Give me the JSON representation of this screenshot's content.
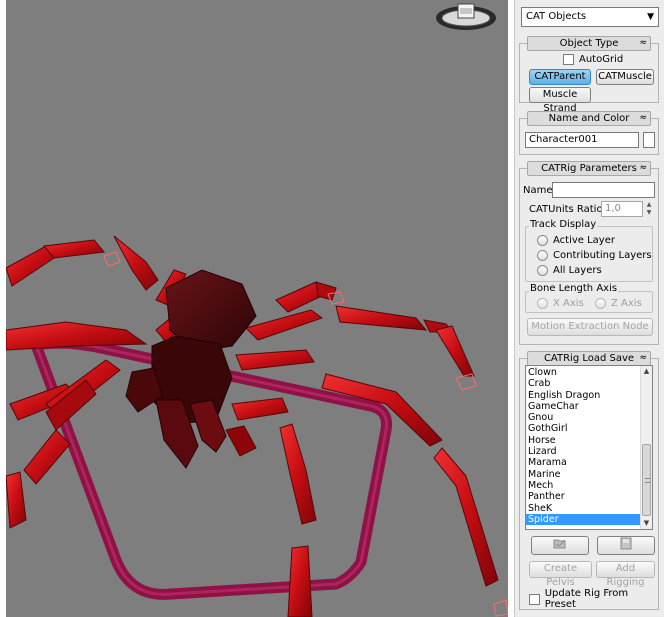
{
  "panel": {
    "category_dropdown": "CAT Objects",
    "rollouts": {
      "object_type": {
        "title": "Object Type",
        "autogrid_label": "AutoGrid",
        "buttons": [
          "CATParent",
          "CATMuscle",
          "Muscle Strand"
        ]
      },
      "name_color": {
        "title": "Name and Color",
        "name_value": "Character001"
      },
      "catrig_params": {
        "title": "CATRig Parameters",
        "name_label": "Name:",
        "name_value": "",
        "units_label": "CATUnits Ratio:",
        "units_value": "1,0",
        "track_display_label": "Track Display",
        "track_options": [
          "Active Layer",
          "Contributing Layers",
          "All Layers"
        ],
        "bone_axis_label": "Bone Length Axis",
        "axis_options": [
          "X Axis",
          "Z Axis"
        ],
        "motion_button": "Motion Extraction Node"
      },
      "load_save": {
        "title": "CATRig Load Save",
        "presets": [
          "Clown",
          "Crab",
          "English Dragon",
          "GameChar",
          "Gnou",
          "GothGirl",
          "Horse",
          "Lizard",
          "Marama",
          "Marine",
          "Mech",
          "Panther",
          "SheK",
          "Spider"
        ],
        "selected_preset": "Spider",
        "create_pelvis_label": "Create Pelvis",
        "add_rigging_label": "Add Rigging",
        "update_rig_label": "Update Rig From Preset"
      }
    }
  },
  "icons": {
    "rollout_toggle": "collapse-icon",
    "open_preset": "open-preset-icon",
    "save_preset": "save-preset-icon"
  },
  "colors": {
    "viewport_bg": "#7e7e7e",
    "spider_body": "#4a0a0c",
    "spider_leg": "#e0161a",
    "path_curve": "#8e1245",
    "selected_item": "#3399ff",
    "active_button": "#6cb8ea"
  }
}
